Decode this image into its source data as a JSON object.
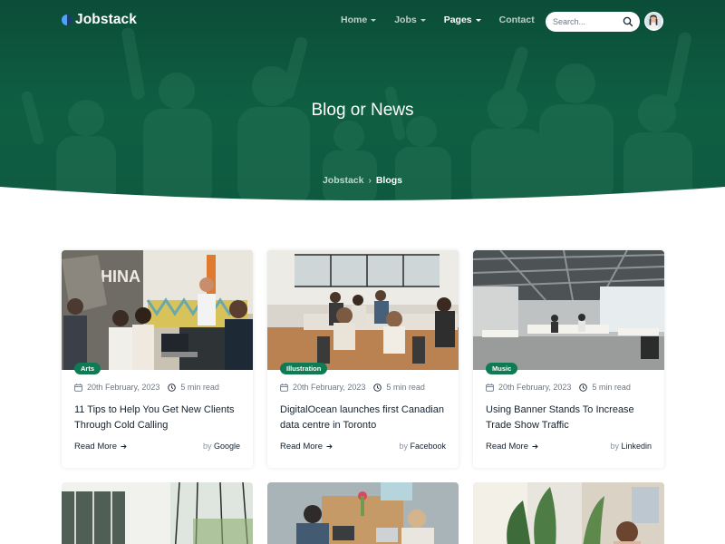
{
  "brand": {
    "name": "Jobstack"
  },
  "nav": {
    "items": [
      {
        "label": "Home",
        "has_caret": true
      },
      {
        "label": "Jobs",
        "has_caret": true
      },
      {
        "label": "Pages",
        "has_caret": true
      },
      {
        "label": "Contact",
        "has_caret": false
      }
    ],
    "active": "Pages",
    "search_placeholder": "Search...",
    "search_icon": "search-icon",
    "avatar_icon": "user-avatar"
  },
  "hero": {
    "title": "Blog or News",
    "breadcrumb": {
      "home": "Jobstack",
      "separator": "›",
      "current": "Blogs"
    }
  },
  "colors": {
    "hero_green": "#0f5f43",
    "accent_green": "#0f7a53",
    "text_dark": "#14212e",
    "text_muted": "#6b7785"
  },
  "posts": [
    {
      "tag": "Arts",
      "date": "20th February, 2023",
      "read_time": "5 min read",
      "title": "11 Tips to Help You Get New Clients Through Cold Calling",
      "read_more": "Read More",
      "by_prefix": "by",
      "author": "Google"
    },
    {
      "tag": "Illustration",
      "date": "20th February, 2023",
      "read_time": "5 min read",
      "title": "DigitalOcean launches first Canadian data centre in Toronto",
      "read_more": "Read More",
      "by_prefix": "by",
      "author": "Facebook"
    },
    {
      "tag": "Music",
      "date": "20th February, 2023",
      "read_time": "5 min read",
      "title": "Using Banner Stands To Increase Trade Show Traffic",
      "read_more": "Read More",
      "by_prefix": "by",
      "author": "Linkedin"
    }
  ],
  "icons": {
    "calendar": "calendar-icon",
    "clock": "clock-icon",
    "arrow": "arrow-right-icon"
  }
}
